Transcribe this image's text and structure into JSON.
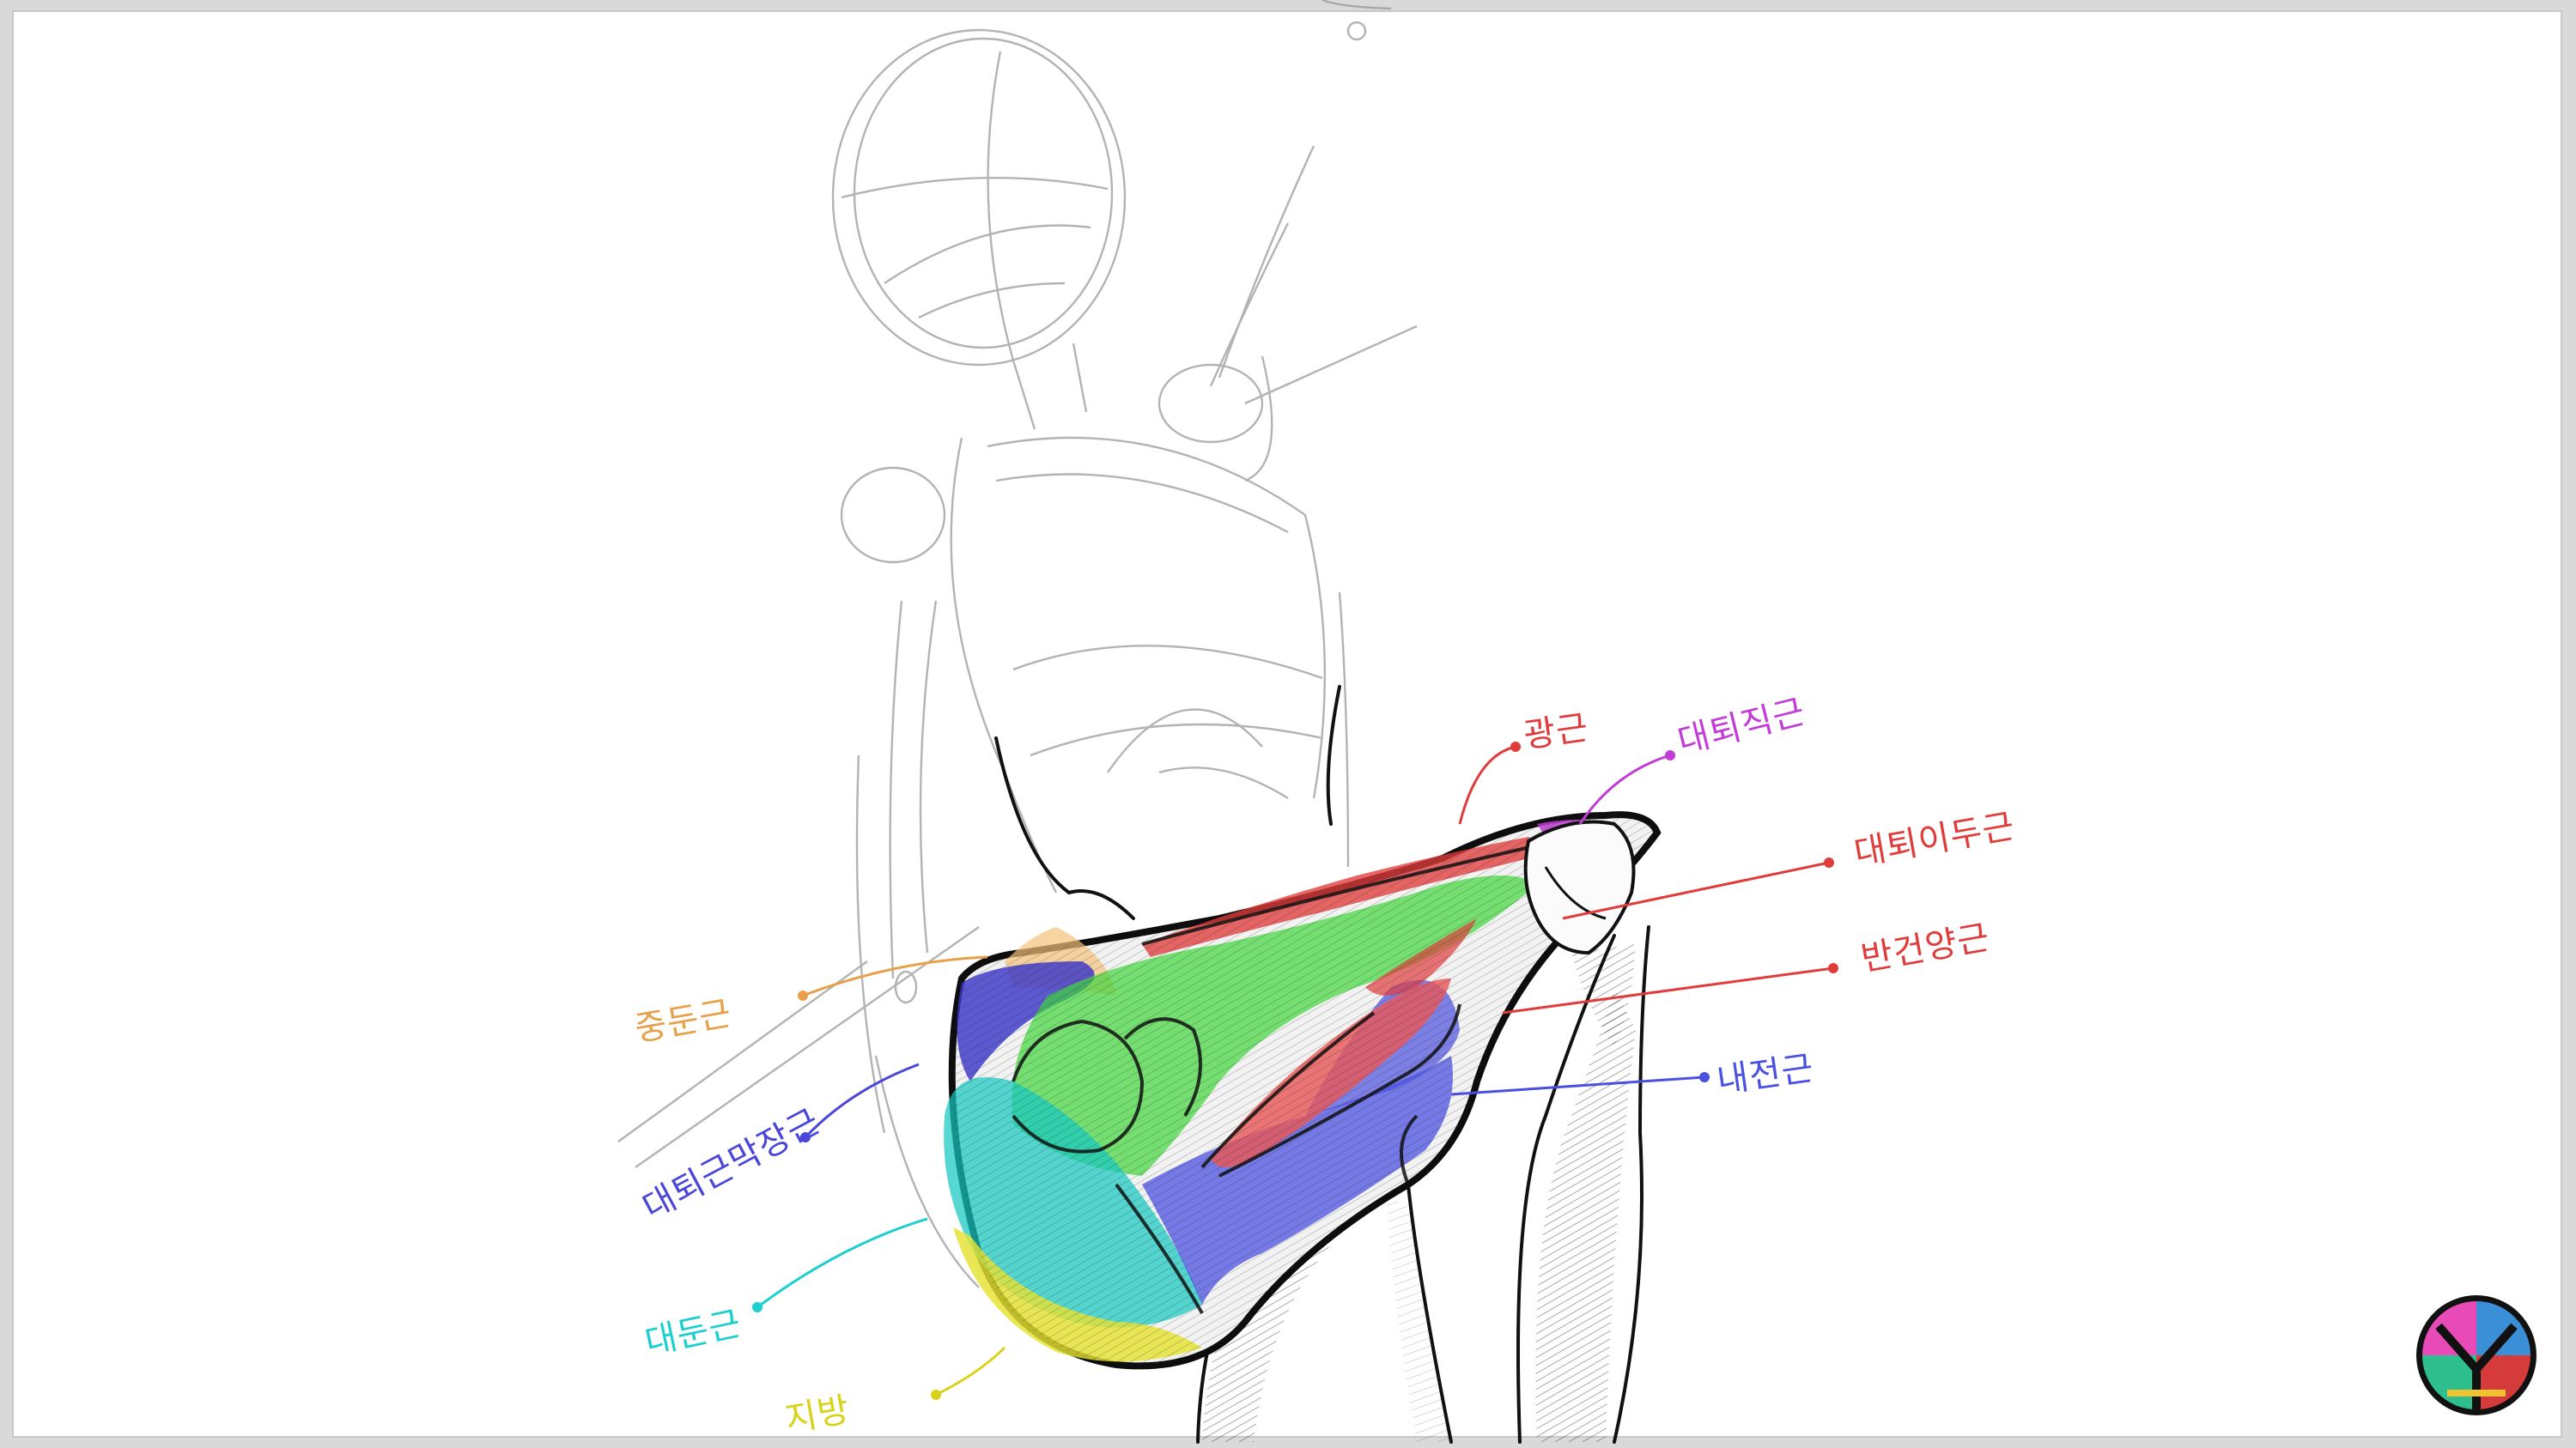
{
  "labels": {
    "gluteus_medius": {
      "text": "중둔근",
      "color": "#e8a04a"
    },
    "tensor_fasciae_latae": {
      "text": "대퇴근막장근",
      "color": "#4a46d8"
    },
    "gluteus_maximus": {
      "text": "대둔근",
      "color": "#1ccfcf"
    },
    "fat": {
      "text": "지방",
      "color": "#d9d21a"
    },
    "sartorius": {
      "text": "광근",
      "color": "#e03c3c"
    },
    "rectus_femoris": {
      "text": "대퇴직근",
      "color": "#c23cd6"
    },
    "biceps_femoris": {
      "text": "대퇴이두근",
      "color": "#e03c3c"
    },
    "semitendinosus": {
      "text": "반건양근",
      "color": "#e03c3c"
    },
    "adductor": {
      "text": "내전근",
      "color": "#4a50e0"
    }
  },
  "logo": {
    "colors": [
      "#3b8fd6",
      "#d63b3b",
      "#2fbf8f",
      "#e84bb8",
      "#f0c430"
    ]
  }
}
